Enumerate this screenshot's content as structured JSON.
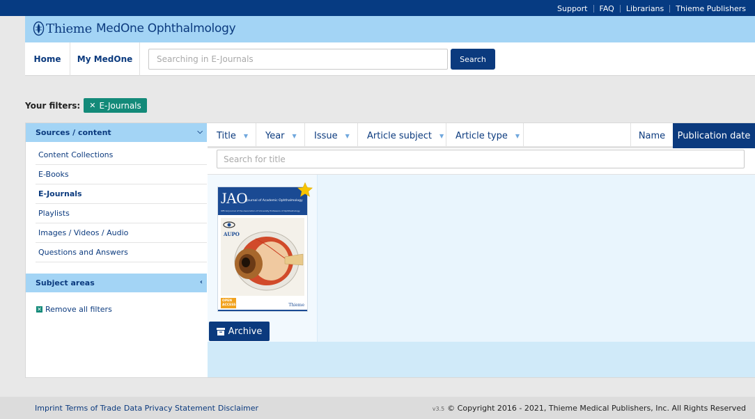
{
  "top_links": [
    "Support",
    "FAQ",
    "Librarians",
    "Thieme Publishers"
  ],
  "brand": {
    "name": "Thieme",
    "product": "MedOne Ophthalmology"
  },
  "nav": {
    "home": "Home",
    "my_medone": "My MedOne"
  },
  "search": {
    "placeholder": "Searching in E-Journals",
    "button": "Search"
  },
  "filters": {
    "label": "Your filters:",
    "active_chip": "E-Journals"
  },
  "sidebar": {
    "sources_header": "Sources / content",
    "items": [
      {
        "label": "Content Collections",
        "active": false
      },
      {
        "label": "E-Books",
        "active": false
      },
      {
        "label": "E-Journals",
        "active": true
      },
      {
        "label": "Playlists",
        "active": false
      },
      {
        "label": "Images / Videos / Audio",
        "active": false
      },
      {
        "label": "Questions and Answers",
        "active": false
      }
    ],
    "subject_header": "Subject areas",
    "remove_all": "Remove all filters"
  },
  "sort": {
    "columns": [
      "Title",
      "Year",
      "Issue",
      "Article subject",
      "Article type"
    ],
    "name": "Name",
    "publication_date": "Publication date"
  },
  "title_search": {
    "placeholder": "Search for title"
  },
  "result": {
    "cover_abbrev": "JAO",
    "cover_title": "Journal of Academic Ophthalmology",
    "cover_subtitle": "Official Journal of the Association of University Professors of Ophthalmology",
    "cover_org": "AUPO",
    "cover_oa": "OPEN ACCESS",
    "cover_publisher": "Thieme",
    "archive_label": "Archive",
    "favorite_icon": "star-icon"
  },
  "footer": {
    "links": [
      "Imprint",
      "Terms of Trade",
      "Data Privacy Statement",
      "Disclaimer"
    ],
    "version": "v3.5",
    "copyright": "© Copyright 2016 - 2021, Thieme Medical Publishers, Inc. All Rights Reserved"
  },
  "colors": {
    "navy": "#0b3a7e",
    "top_bar": "#063b82",
    "light_blue": "#a3d4f5",
    "teal": "#138a79",
    "star": "#f7c400"
  }
}
